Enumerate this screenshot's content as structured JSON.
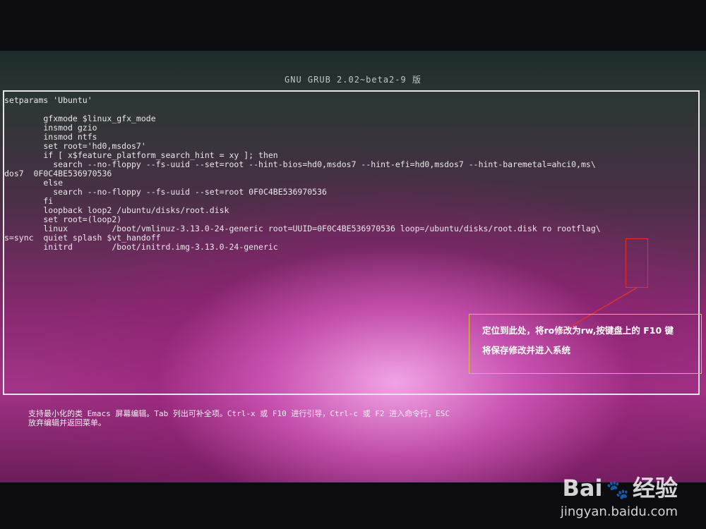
{
  "header": {
    "title": "GNU GRUB  2.02~beta2-9 版"
  },
  "editor": {
    "lines": [
      "setparams 'Ubuntu'",
      "",
      "        gfxmode $linux_gfx_mode",
      "        insmod gzio",
      "        insmod ntfs",
      "        set root='hd0,msdos7'",
      "        if [ x$feature_platform_search_hint = xy ]; then",
      "          search --no-floppy --fs-uuid --set=root --hint-bios=hd0,msdos7 --hint-efi=hd0,msdos7 --hint-baremetal=ahci0,ms\\",
      "dos7  0F0C4BE536970536",
      "        else",
      "          search --no-floppy --fs-uuid --set=root 0F0C4BE536970536",
      "        fi",
      "        loopback loop2 /ubuntu/disks/root.disk",
      "        set root=(loop2)",
      "        linux         /boot/vmlinuz-3.13.0-24-generic root=UUID=0F0C4BE536970536 loop=/ubuntu/disks/root.disk ro rootflag\\",
      "s=sync  quiet splash $vt_handoff",
      "        initrd        /boot/initrd.img-3.13.0-24-generic"
    ]
  },
  "annotation": {
    "line1": "定位到此处，将ro修改为rw,按键盘上的 F10 键",
    "line2": "将保存修改并进入系统",
    "border_color": "#d9c03a",
    "highlight_color": "#e0322a"
  },
  "help": {
    "line1": "支持最小化的类 Emacs 屏幕编辑。Tab 列出可补全项。Ctrl-x 或 F10 进行引导，Ctrl-c 或 F2 进入命令行，ESC",
    "line2": "放弃编辑并返回菜单。"
  },
  "watermark": {
    "brand": "Bai",
    "paw_icon": "paw-icon",
    "brand_suffix": "经验",
    "url": "jingyan.baidu.com"
  }
}
